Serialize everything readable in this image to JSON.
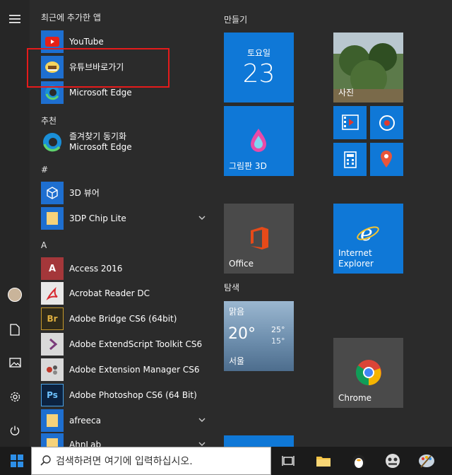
{
  "sidebar": {
    "menu_label": "menu",
    "items": [
      "user",
      "documents",
      "pictures",
      "settings",
      "power"
    ]
  },
  "applist": {
    "recent_header": "최근에 추가한 앱",
    "recent": [
      {
        "label": "YouTube",
        "icon": "youtube-icon"
      },
      {
        "label": "유튜브바로가기",
        "icon": "youtube-shortcut-icon"
      },
      {
        "label": "Microsoft Edge",
        "icon": "edge-icon"
      }
    ],
    "recommended_header": "추천",
    "recommended": [
      {
        "line1": "즐겨찾기 동기화",
        "line2": "Microsoft Edge",
        "icon": "edge-icon"
      }
    ],
    "hash_header": "#",
    "hash_apps": [
      {
        "label": "3D 뷰어",
        "icon": "3d-viewer-icon"
      },
      {
        "label": "3DP Chip Lite",
        "icon": "folder-icon"
      }
    ],
    "a_header": "A",
    "a_apps": [
      {
        "label": "Access 2016",
        "icon": "access-icon"
      },
      {
        "label": "Acrobat Reader DC",
        "icon": "acrobat-icon"
      },
      {
        "label": "Adobe Bridge CS6 (64bit)",
        "icon": "bridge-icon"
      },
      {
        "label": "Adobe ExtendScript Toolkit CS6",
        "icon": "extendscript-icon"
      },
      {
        "label": "Adobe Extension Manager CS6",
        "icon": "extension-manager-icon"
      },
      {
        "label": "Adobe Photoshop CS6 (64 Bit)",
        "icon": "photoshop-icon"
      },
      {
        "label": "afreeca",
        "icon": "folder-icon"
      },
      {
        "label": "AhnLab",
        "icon": "folder-icon"
      }
    ]
  },
  "tiles": {
    "group1_header": "만들기",
    "calendar": {
      "weekday": "토요일",
      "day": "23"
    },
    "photos_label": "사진",
    "paint3d_label": "그림판 3D",
    "office_label": "Office",
    "ie_label_line1": "Internet",
    "ie_label_line2": "Explorer",
    "group2_header": "탐색",
    "weather": {
      "condition": "맑음",
      "temp": "20°",
      "high": "25°",
      "low": "15°",
      "city": "서울"
    },
    "chrome_label": "Chrome"
  },
  "taskbar": {
    "search_placeholder": "검색하려면 여기에 입력하십시오."
  },
  "colors": {
    "accent": "#1e6fd0",
    "tile_blue": "#0f78d7",
    "highlight": "#e51b1b"
  }
}
